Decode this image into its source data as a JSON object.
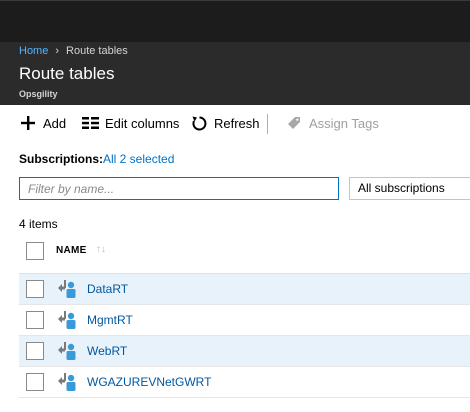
{
  "header": {
    "breadcrumb": [
      "Home",
      "Route tables"
    ],
    "title": "Route tables",
    "subtitle": "Opsgility"
  },
  "toolbar": {
    "add": "Add",
    "edit_columns": "Edit columns",
    "refresh": "Refresh",
    "assign_tags": "Assign Tags"
  },
  "subscriptions": {
    "label": "Subscriptions:",
    "value": "All 2 selected"
  },
  "filter": {
    "placeholder": "Filter by name...",
    "subscription_select": "All subscriptions"
  },
  "list": {
    "count": "4 items",
    "column_name": "NAME",
    "rows": [
      {
        "name": "DataRT"
      },
      {
        "name": "MgmtRT"
      },
      {
        "name": "WebRT"
      },
      {
        "name": "WGAZUREVNetGWRT"
      }
    ]
  },
  "colors": {
    "accent": "#0072c6",
    "header_bg": "#2b2b2b",
    "topbar_bg": "#1c1c1c",
    "row_highlight": "#e8f2fa"
  }
}
